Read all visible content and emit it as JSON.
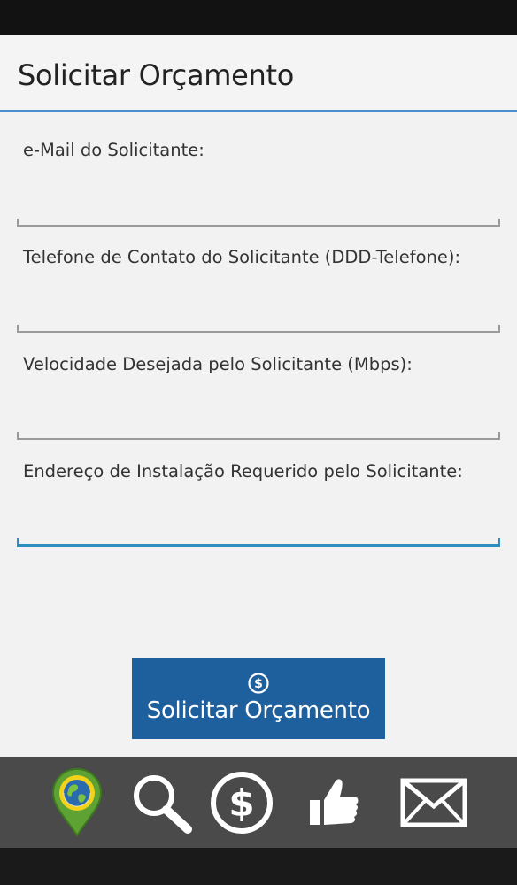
{
  "app": {
    "title": "Solicitar Orçamento"
  },
  "form": {
    "email_label": "e-Mail do Solicitante:",
    "phone_label": "Telefone de Contato do Solicitante (DDD-Telefone):",
    "speed_label": "Velocidade Desejada pelo Solicitante (Mbps):",
    "address_label": "Endereço de Instalação Requerido pelo Solicitante:",
    "email_value": "",
    "phone_value": "",
    "speed_value": "",
    "address_value": ""
  },
  "submit": {
    "label": "Solicitar Orçamento",
    "icon": "dollar-circle-icon"
  },
  "bottom_nav": {
    "items": [
      {
        "name": "map-pin-globe-icon"
      },
      {
        "name": "search-icon"
      },
      {
        "name": "dollar-icon"
      },
      {
        "name": "thumbs-up-icon"
      },
      {
        "name": "mail-icon"
      }
    ]
  },
  "colors": {
    "accent": "#2d8fbf",
    "button": "#1e5f9e",
    "action_bar_divider": "#4a8fd0",
    "nav_background": "#4a4a4a"
  }
}
